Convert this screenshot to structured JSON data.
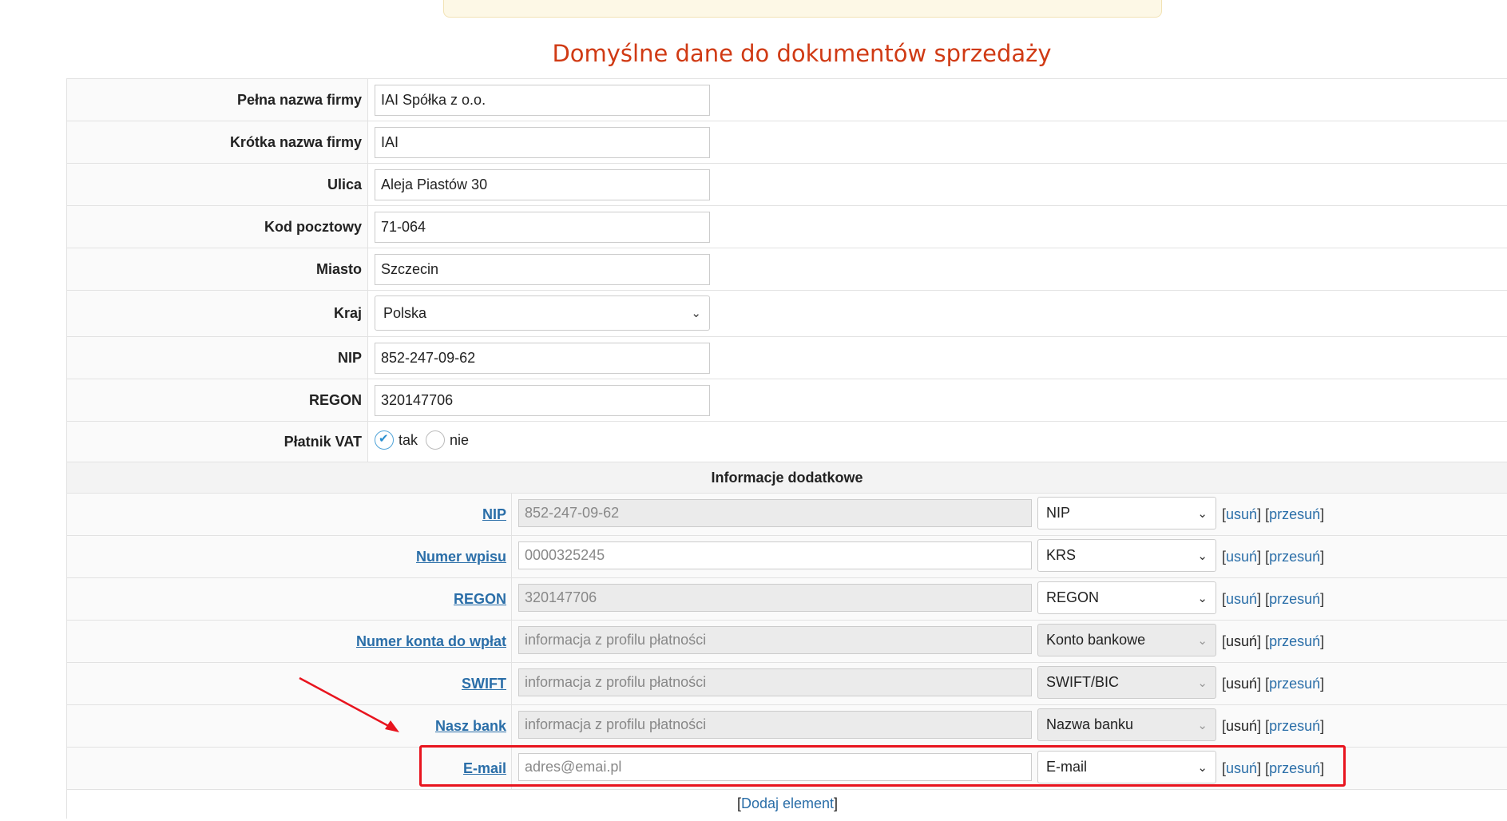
{
  "page_title": "Domyślne dane do dokumentów sprzedaży",
  "fields": [
    {
      "label": "Pełna nazwa firmy",
      "value": "IAI Spółka z o.o."
    },
    {
      "label": "Krótka nazwa firmy",
      "value": "IAI"
    },
    {
      "label": "Ulica",
      "value": "Aleja Piastów 30"
    },
    {
      "label": "Kod pocztowy",
      "value": "71-064"
    },
    {
      "label": "Miasto",
      "value": "Szczecin"
    }
  ],
  "country": {
    "label": "Kraj",
    "value": "Polska"
  },
  "nip": {
    "label": "NIP",
    "value": "852-247-09-62"
  },
  "regon": {
    "label": "REGON",
    "value": "320147706"
  },
  "vat": {
    "label": "Płatnik VAT",
    "yes": "tak",
    "no": "nie",
    "selected": "tak"
  },
  "section_title": "Informacje dodatkowe",
  "extra": [
    {
      "label": "NIP",
      "value": "852-247-09-62",
      "type": "NIP",
      "remove": "usuń",
      "move": "przesuń"
    },
    {
      "label": "Numer wpisu",
      "value": "0000325245",
      "type": "KRS",
      "remove": "usuń",
      "move": "przesuń"
    },
    {
      "label": "REGON",
      "value": "320147706",
      "type": "REGON",
      "remove": "usuń",
      "move": "przesuń"
    },
    {
      "label": "Numer konta do wpłat",
      "value": "informacja z profilu płatności",
      "type": "Konto bankowe",
      "remove": "usuń",
      "move": "przesuń"
    },
    {
      "label": "SWIFT",
      "value": "informacja z profilu płatności",
      "type": "SWIFT/BIC",
      "remove": "usuń",
      "move": "przesuń"
    },
    {
      "label": "Nasz bank",
      "value": "informacja z profilu płatności",
      "type": "Nazwa banku",
      "remove": "usuń",
      "move": "przesuń"
    },
    {
      "label": "E-mail",
      "placeholder": "adres@emai.pl",
      "type": "E-mail",
      "remove": "usuń",
      "move": "przesuń"
    }
  ],
  "add_element": "Dodaj element",
  "colors": {
    "title": "#d03a14",
    "link": "#2a6ea8",
    "highlight": "#e8141e"
  }
}
